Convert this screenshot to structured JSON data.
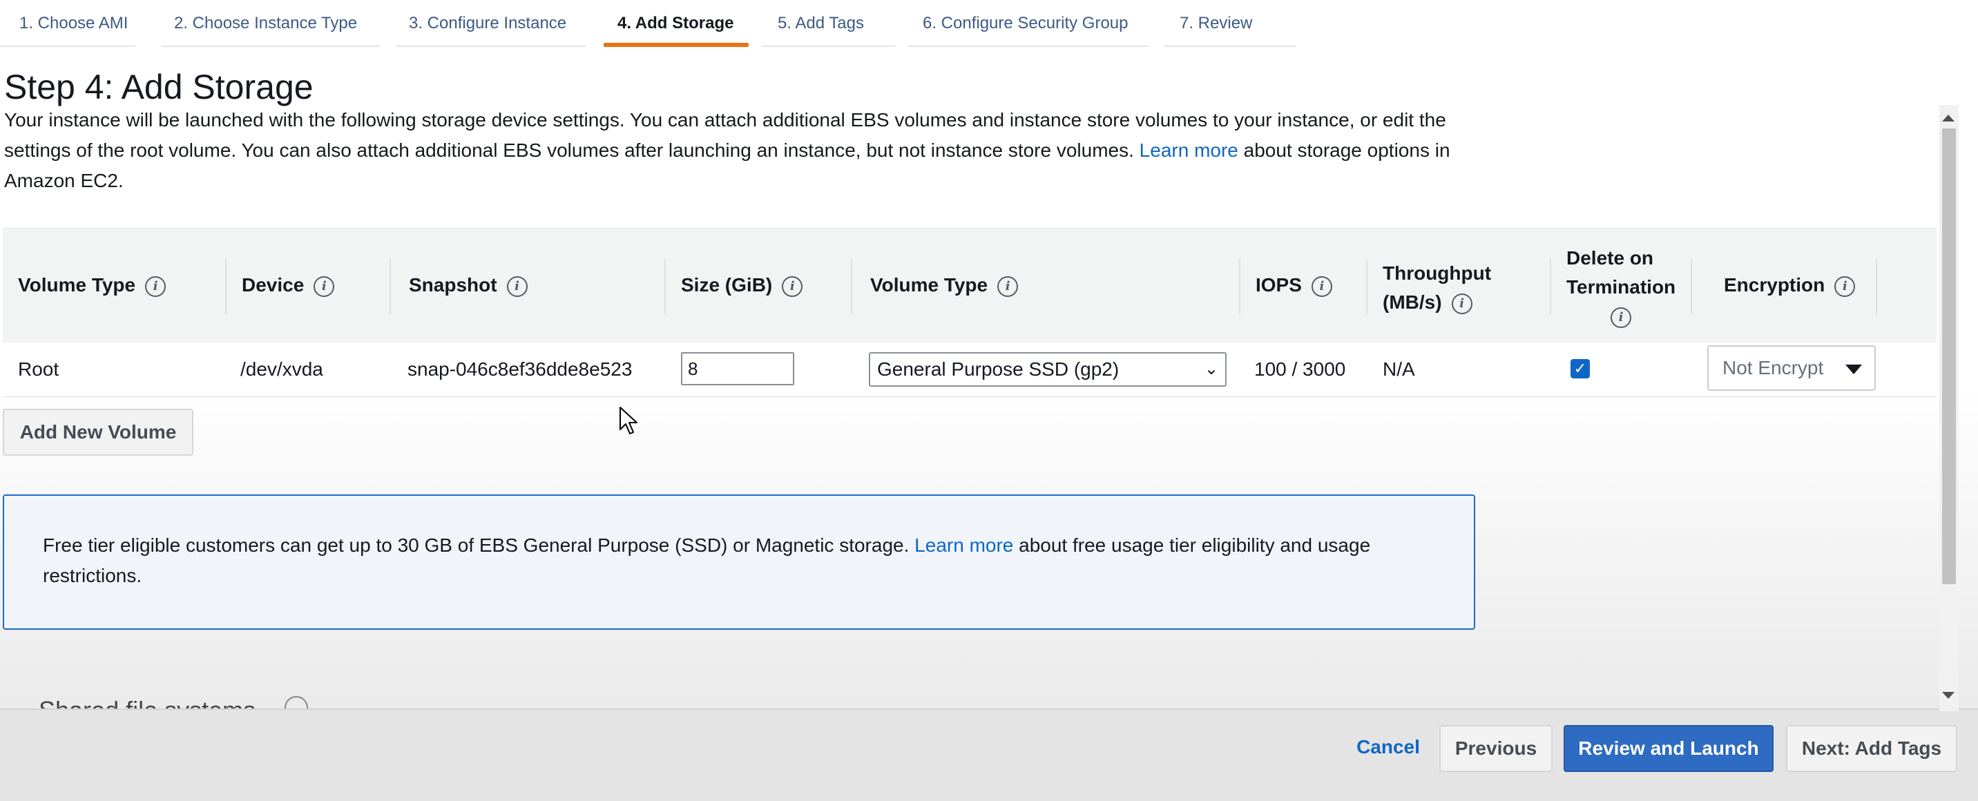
{
  "wizard": {
    "steps": [
      "1. Choose AMI",
      "2. Choose Instance Type",
      "3. Configure Instance",
      "4. Add Storage",
      "5. Add Tags",
      "6. Configure Security Group",
      "7. Review"
    ],
    "active_step": "4. Add Storage"
  },
  "page": {
    "title": "Step 4: Add Storage",
    "intro_text_1": "Your instance will be launched with the following storage device settings. You can attach additional EBS volumes and instance store volumes to your instance, or edit the settings of the root volume. You can also attach additional EBS volumes after launching an instance, but not instance store volumes.",
    "intro_link": "Learn more",
    "intro_text_2": "about storage options in Amazon EC2."
  },
  "table": {
    "headers": {
      "volume_type": "Volume Type",
      "device": "Device",
      "snapshot": "Snapshot",
      "size": "Size (GiB)",
      "volume_type_2": "Volume Type",
      "iops": "IOPS",
      "throughput_1": "Throughput",
      "throughput_2": "(MB/s)",
      "delete_1": "Delete on",
      "delete_2": "Termination",
      "encryption": "Encryption"
    },
    "row": {
      "volume_type": "Root",
      "device": "/dev/xvda",
      "snapshot": "snap-046c8ef36dde8e523",
      "size": "8",
      "volume_type_select": "General Purpose SSD (gp2)",
      "iops": "100 / 3000",
      "throughput": "N/A",
      "delete_on_termination": true,
      "encryption": "Not Encrypt"
    }
  },
  "buttons": {
    "add_new_volume": "Add New Volume",
    "cancel": "Cancel",
    "previous": "Previous",
    "review_and_launch": "Review and Launch",
    "next": "Next: Add Tags"
  },
  "free_tier": {
    "text_1": "Free tier eligible customers can get up to 30 GB of EBS General Purpose (SSD) or Magnetic storage.",
    "link": "Learn more",
    "text_2": "about free usage tier eligibility and usage restrictions."
  },
  "clipped_section_heading": "Shared file systems",
  "icons": {
    "info": "i",
    "checkmark": "✓",
    "chevron_down": "⌄"
  },
  "colors": {
    "active_tab": "#ec7211",
    "link": "#0f66c7",
    "primary_button": "#2e6bc2",
    "info_box_border": "#1c6ac2"
  }
}
